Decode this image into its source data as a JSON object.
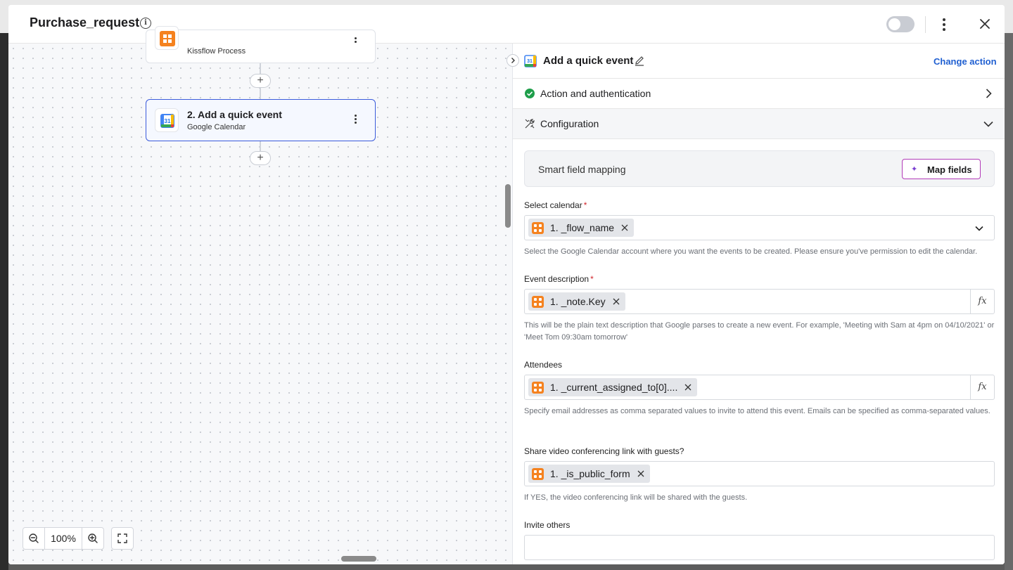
{
  "header": {
    "title": "Purchase_request",
    "info_icon": "info-icon",
    "toggle_state": "off"
  },
  "canvas": {
    "nodes": [
      {
        "title": "",
        "subtitle": "Kissflow Process",
        "icon": "kissflow-icon"
      },
      {
        "title": "2. Add a quick event",
        "subtitle": "Google Calendar",
        "icon": "google-calendar-icon"
      }
    ],
    "zoom_label": "100%"
  },
  "panel": {
    "title": "Add a quick event",
    "change_action": "Change action",
    "sections": {
      "auth": "Action and authentication",
      "config": "Configuration"
    },
    "smart_mapping": {
      "label": "Smart field mapping",
      "button": "Map fields"
    },
    "fields": {
      "calendar": {
        "label": "Select calendar",
        "required": "*",
        "chip": "1. _flow_name",
        "help": "Select the Google Calendar account where you want the events to be created. Please ensure you've permission to edit the calendar."
      },
      "description": {
        "label": "Event description",
        "required": "*",
        "chip": "1. _note.Key",
        "fx": "fx",
        "help": "This will be the plain text description that Google parses to create a new event. For example, 'Meeting with Sam at 4pm on 04/10/2021' or 'Meet Tom 09:30am tomorrow'"
      },
      "attendees": {
        "label": "Attendees",
        "chip": "1. _current_assigned_to[0]....",
        "fx": "fx",
        "help": "Specify email addresses as comma separated values to invite to attend this event. Emails can be specified as comma-separated values."
      },
      "video_link": {
        "label": "Share video conferencing link with guests?",
        "chip": "1. _is_public_form",
        "help": "If YES, the video conferencing link will be shared with the guests."
      },
      "invite_others": {
        "label": "Invite others"
      }
    }
  },
  "colors": {
    "accent_blue": "#1f5fd1",
    "selected_border": "#3b5bdb",
    "kissflow_orange": "#f5821f",
    "success_green": "#1e9e4a",
    "required_red": "#d1252c",
    "map_button_border": "#b23bb8"
  }
}
